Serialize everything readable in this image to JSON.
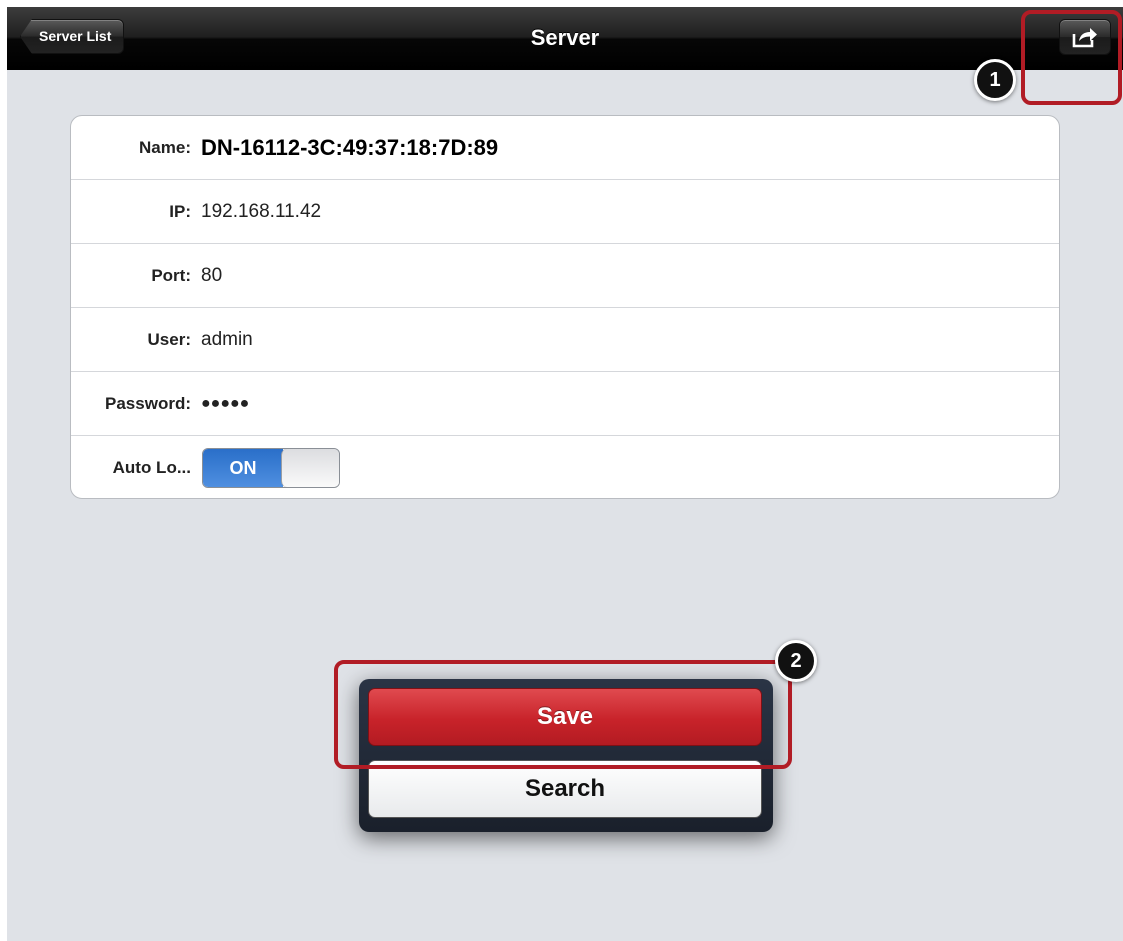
{
  "nav": {
    "back_label": "Server List",
    "title": "Server",
    "share_icon": "share-icon"
  },
  "fields": [
    {
      "label": "Name:",
      "value": "DN-16112-3C:49:37:18:7D:89"
    },
    {
      "label": "IP:",
      "value": "192.168.11.42"
    },
    {
      "label": "Port:",
      "value": "80"
    },
    {
      "label": "User:",
      "value": "admin"
    },
    {
      "label": "Password:",
      "value": "●●●●●"
    },
    {
      "label": "Auto Lo...",
      "toggle": "ON"
    }
  ],
  "actions": {
    "save_label": "Save",
    "search_label": "Search"
  },
  "annotations": {
    "badge1": "1",
    "badge2": "2",
    "highlight_color": "#b11c25"
  },
  "colors": {
    "save": "#c8232a",
    "toggle_on": "#2a6fc9",
    "background": "#dfe2e7"
  }
}
